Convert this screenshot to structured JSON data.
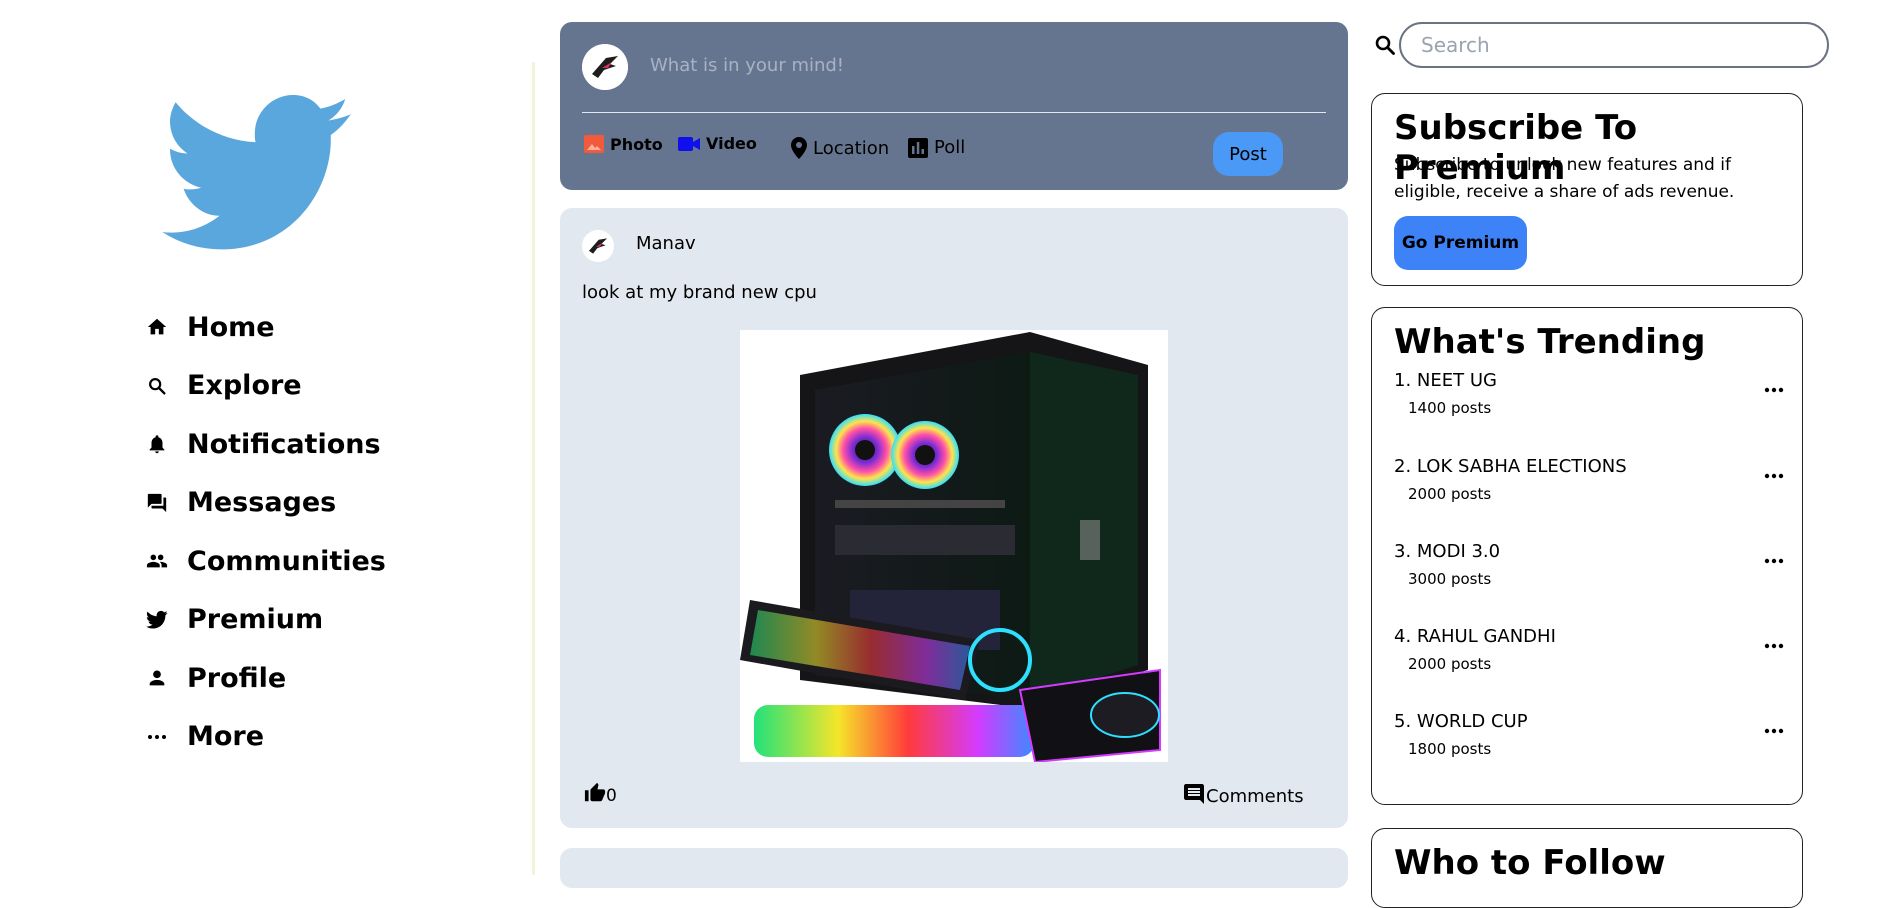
{
  "nav": {
    "items": [
      {
        "label": "Home",
        "icon": "home-icon"
      },
      {
        "label": "Explore",
        "icon": "search-icon"
      },
      {
        "label": "Notifications",
        "icon": "bell-icon"
      },
      {
        "label": "Messages",
        "icon": "messages-icon"
      },
      {
        "label": "Communities",
        "icon": "people-icon"
      },
      {
        "label": "Premium",
        "icon": "twitter-bird-icon"
      },
      {
        "label": "Profile",
        "icon": "person-icon"
      },
      {
        "label": "More",
        "icon": "more-horizontal-icon"
      }
    ]
  },
  "composer": {
    "placeholder": "What is in your mind!",
    "tools": {
      "photo": "Photo",
      "video": "Video",
      "location": "Location",
      "poll": "Poll"
    },
    "post_label": "Post"
  },
  "post": {
    "author": "Manav",
    "text": "look at my brand new cpu",
    "likes": "0",
    "comments_label": "Comments"
  },
  "search": {
    "placeholder": "Search"
  },
  "premium": {
    "title": "Subscribe To Premium",
    "description": "Subscribe to unlock new features and if eligible, receive a share of ads revenue.",
    "button": "Go Premium"
  },
  "trending": {
    "title": "What's Trending",
    "items": [
      {
        "name": "1. NEET UG",
        "count": "1400 posts"
      },
      {
        "name": "2. LOK SABHA ELECTIONS",
        "count": "2000 posts"
      },
      {
        "name": "3. MODI 3.0",
        "count": "3000 posts"
      },
      {
        "name": "4. RAHUL GANDHI",
        "count": "2000 posts"
      },
      {
        "name": "5. WORLD CUP",
        "count": "1800 posts"
      }
    ]
  },
  "follow": {
    "title": "Who to Follow"
  },
  "colors": {
    "brand": "#5aa7dd",
    "composer_bg": "#66758f",
    "card_bg": "#e2e8f0",
    "accent": "#3d82f6"
  }
}
